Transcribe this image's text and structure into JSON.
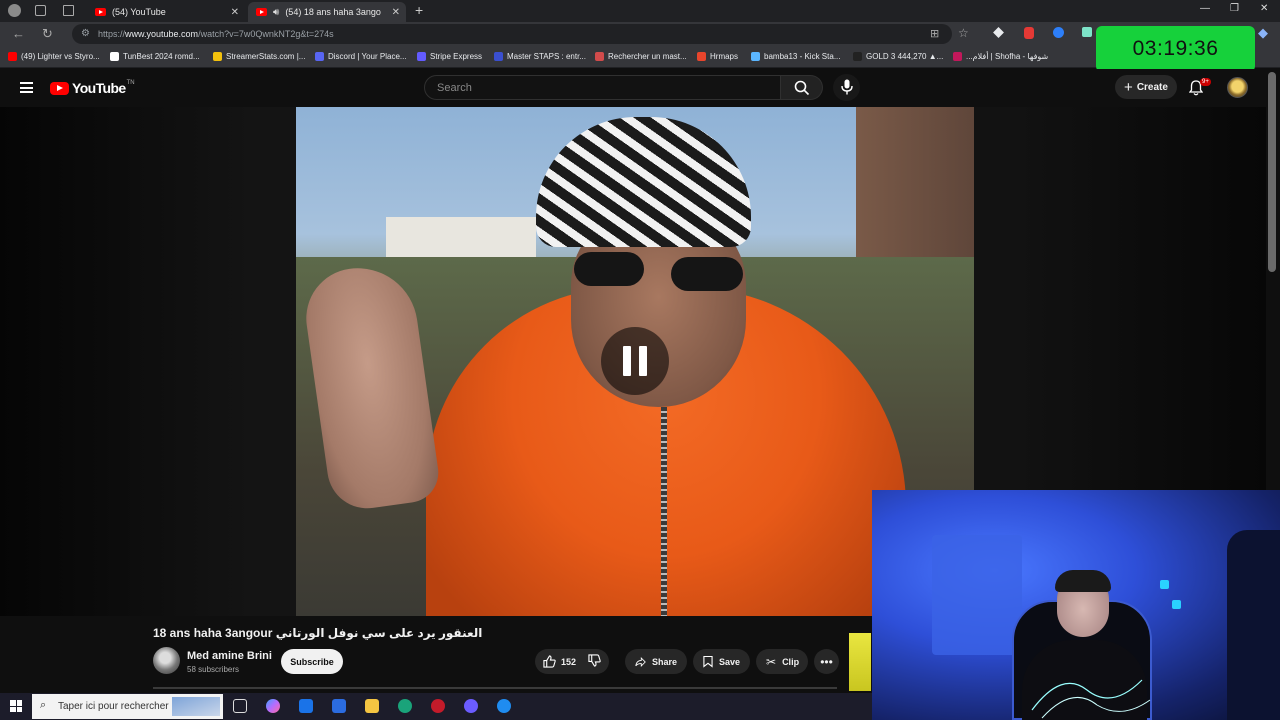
{
  "browser": {
    "tabs": [
      {
        "title": "(54) YouTube",
        "active": false
      },
      {
        "title": "(54) 18 ans haha 3angour",
        "active": true
      }
    ],
    "url_prefix": "https://",
    "url_domain": "www.youtube.com",
    "url_path": "/watch?v=7w0QwnkNT2g&t=274s"
  },
  "bookmarks": [
    {
      "label": "(49) Lighter vs Styro...",
      "color": "#ff0000"
    },
    {
      "label": "TunBest 2024 romd...",
      "color": "#ffffff"
    },
    {
      "label": "StreamerStats.com |...",
      "color": "#f4c20d"
    },
    {
      "label": "Discord | Your Place...",
      "color": "#5865f2"
    },
    {
      "label": "Stripe Express",
      "color": "#635bff"
    },
    {
      "label": "Master STAPS : entr...",
      "color": "#3a4fd0"
    },
    {
      "label": "Rechercher un mast...",
      "color": "#d14b4b"
    },
    {
      "label": "Hrmaps",
      "color": "#e8452c"
    },
    {
      "label": "bamba13 - Kick Sta...",
      "color": "#5bb6ff"
    },
    {
      "label": "GOLD 3 444,270 ▲...",
      "color": "#222222"
    },
    {
      "label": "...أفلام | Shofha - شوفها",
      "color": "#c2185b"
    }
  ],
  "timer": "03:19:36",
  "youtube": {
    "logo": "YouTube",
    "country": "TN",
    "search_placeholder": "Search",
    "create_label": "Create",
    "notif_badge": "9+"
  },
  "video": {
    "title": "18 ans haha 3angour العنقور يرد على سي نوفل الورتاني",
    "channel": "Med amine Brini",
    "subscribers": "58 subscribers",
    "subscribe_label": "Subscribe",
    "likes": "152",
    "share_label": "Share",
    "save_label": "Save",
    "clip_label": "Clip"
  },
  "taskbar": {
    "search_placeholder": "Taper ici pour rechercher"
  }
}
